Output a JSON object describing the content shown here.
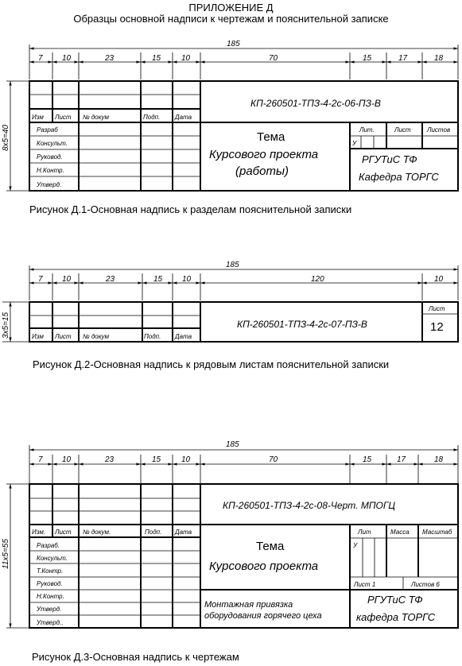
{
  "header": {
    "line1": "ПРИЛОЖЕНИЕ Д",
    "line2": "Образцы основной надписи к чертежам и пояснительной записке"
  },
  "dims": {
    "total": "185",
    "d7": "7",
    "d10": "10",
    "d23": "23",
    "d15": "15",
    "d70": "70",
    "d17": "17",
    "d18": "18",
    "d120": "120"
  },
  "cols": {
    "izm": "Изм",
    "izm_dot": "Изм.",
    "list": "Лист",
    "ndoc": "№ докум",
    "ndoc_dot": "№ докум.",
    "podp": "Подп.",
    "data": "Дата"
  },
  "roles": {
    "razrab": "Разраб",
    "razrab_dot": "Разраб.",
    "konsult": "Консульт.",
    "rukovod": "Руковод.",
    "nkontr": "Н.Контр.",
    "utverd": "Утверд.",
    "utverd2": "Утверд..",
    "tkontr": "Т.Контр."
  },
  "fig1": {
    "vertical_dim": "8х5=40",
    "code": "КП-260501-ТПЗ-4-2с-06-ПЗ-В",
    "theme_l1": "Тема",
    "theme_l2": "Курсового проекта",
    "theme_l3": "(работы)",
    "lit": "Лит.",
    "list": "Лист",
    "listov": "Листов",
    "u": "У",
    "org_l1": "РГУТиС ТФ",
    "org_l2": "Кафедра ТОРГС",
    "caption": "Рисунок Д.1-Основная надпись к разделам пояснительной записки"
  },
  "fig2": {
    "vertical_dim": "3х5=15",
    "code": "КП-260501-ТПЗ-4-2с-07-ПЗ-В",
    "list_label": "Лист",
    "list_num": "12",
    "caption": "Рисунок Д.2-Основная надпись к рядовым листам пояснительной записки"
  },
  "fig3": {
    "vertical_dim": "11х5=55",
    "code": "КП-260501-ТПЗ-4-2с-08-Черт. МПОГЦ",
    "theme_l1": "Тема",
    "theme_l2": "Курсового проекта",
    "lit": "Лит",
    "massa": "Масса",
    "masshtab": "Масштаб",
    "u": "У",
    "list1": "Лист 1",
    "listov6": "Листов 6",
    "sheet_l1": "Монтажная привязка",
    "sheet_l2": "оборудования горячего цеха",
    "org_l1": "РГУТиС ТФ",
    "org_l2": "кафедра ТОРГС",
    "caption": "Рисунок Д.3-Основная надпись к чертежам"
  }
}
